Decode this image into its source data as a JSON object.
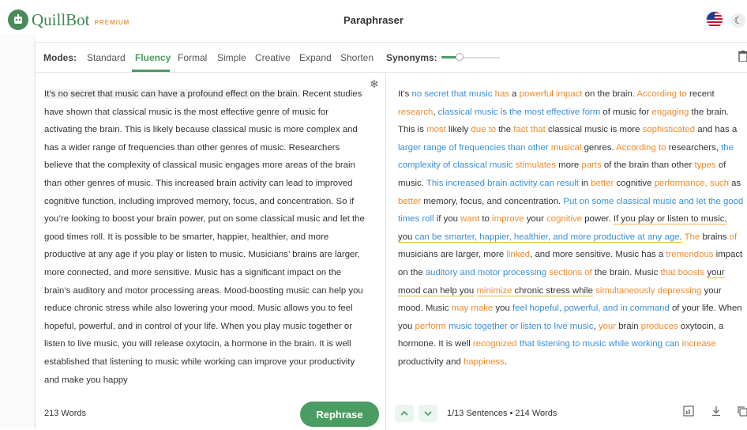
{
  "header": {
    "brand": "QuillBot",
    "brand_badge": "PREMIUM",
    "title": "Paraphraser",
    "flag_icon": "us-flag-icon",
    "theme_icon": "moon-icon"
  },
  "modes": {
    "label": "Modes:",
    "items": [
      "Standard",
      "Fluency",
      "Formal",
      "Simple",
      "Creative",
      "Expand",
      "Shorten"
    ],
    "active": "Fluency"
  },
  "synonyms": {
    "label": "Synonyms:",
    "level": 0.25
  },
  "input": {
    "first_sentence": "It’s no secret that music can have a profound effect on the brain.",
    "rest": " Recent studies have shown that classical music is the most effective genre of music for activating the brain. This is likely because classical music is more complex and has a wider range of frequencies than other genres of music. Researchers believe that the complexity of classical music engages more areas of the brain than other genres of music. This increased brain activity can lead to improved cognitive function, including improved memory, focus, and concentration. So if you’re looking to boost your brain power, put on some classical music and let the good times roll. It is possible to be smarter, happier, healthier, and more productive at any age if you play or listen to music. Musicians’ brains are larger, more connected, and more sensitive. Music has a significant impact on the brain’s auditory and motor processing areas. Mood-boosting music can help you reduce chronic stress while also lowering your mood. Music allows you to feel hopeful, powerful, and in control of your life. When you play music together or listen to live music, you will release oxytocin, a hormone in the brain. It is well established that listening to music while working can improve your productivity and make you happy",
    "word_count": "213 Words"
  },
  "output": {
    "segments": [
      {
        "t": "It’s ",
        "c": ""
      },
      {
        "t": "no secret that music",
        "c": "b"
      },
      {
        "t": " ",
        "c": ""
      },
      {
        "t": "has",
        "c": "o"
      },
      {
        "t": " a ",
        "c": ""
      },
      {
        "t": "powerful impact",
        "c": "o"
      },
      {
        "t": " on the brain. ",
        "c": ""
      },
      {
        "t": "According to",
        "c": "o"
      },
      {
        "t": " recent ",
        "c": ""
      },
      {
        "t": "research",
        "c": "o"
      },
      {
        "t": ", ",
        "c": ""
      },
      {
        "t": "classical music is the most effective",
        "c": "b"
      },
      {
        "t": " ",
        "c": ""
      },
      {
        "t": "form",
        "c": "b"
      },
      {
        "t": " of music for ",
        "c": ""
      },
      {
        "t": "engaging",
        "c": "o"
      },
      {
        "t": " the brain. This is ",
        "c": ""
      },
      {
        "t": "most",
        "c": "o"
      },
      {
        "t": " likely ",
        "c": ""
      },
      {
        "t": "due to",
        "c": "o"
      },
      {
        "t": " the ",
        "c": ""
      },
      {
        "t": "fact that",
        "c": "o"
      },
      {
        "t": " classical music is more ",
        "c": ""
      },
      {
        "t": "sophisticated",
        "c": "o"
      },
      {
        "t": " and has a ",
        "c": ""
      },
      {
        "t": "larger range of frequencies than other",
        "c": "b"
      },
      {
        "t": " ",
        "c": ""
      },
      {
        "t": "musical",
        "c": "o"
      },
      {
        "t": " genres. ",
        "c": ""
      },
      {
        "t": "According to",
        "c": "o"
      },
      {
        "t": " researchers, ",
        "c": ""
      },
      {
        "t": "the complexity of classical music",
        "c": "b"
      },
      {
        "t": " ",
        "c": ""
      },
      {
        "t": "stimulates",
        "c": "o"
      },
      {
        "t": " more ",
        "c": ""
      },
      {
        "t": "parts",
        "c": "o"
      },
      {
        "t": " of the brain than other ",
        "c": ""
      },
      {
        "t": "types",
        "c": "o"
      },
      {
        "t": " of music. ",
        "c": ""
      },
      {
        "t": "This increased brain activity can result",
        "c": "b"
      },
      {
        "t": " in ",
        "c": ""
      },
      {
        "t": "better",
        "c": "o"
      },
      {
        "t": " cognitive ",
        "c": ""
      },
      {
        "t": "performance, such",
        "c": "o"
      },
      {
        "t": " as ",
        "c": ""
      },
      {
        "t": "better",
        "c": "o"
      },
      {
        "t": " memory, focus, and concentration. ",
        "c": ""
      },
      {
        "t": "Put on some classical music and let the good times roll",
        "c": "b"
      },
      {
        "t": " if you ",
        "c": ""
      },
      {
        "t": "want",
        "c": "o"
      },
      {
        "t": " to ",
        "c": ""
      },
      {
        "t": "improve",
        "c": "o"
      },
      {
        "t": " your ",
        "c": ""
      },
      {
        "t": "cognitive",
        "c": "o"
      },
      {
        "t": " power. ",
        "c": ""
      },
      {
        "t": "If you play or listen to music, you ",
        "c": "u"
      },
      {
        "t": "can be smarter, happier, healthier, and more productive at any age",
        "c": "b u"
      },
      {
        "t": ".",
        "c": "u"
      },
      {
        "t": " ",
        "c": ""
      },
      {
        "t": "The",
        "c": "o"
      },
      {
        "t": " brains ",
        "c": ""
      },
      {
        "t": "of",
        "c": "o"
      },
      {
        "t": " musicians are larger, more ",
        "c": ""
      },
      {
        "t": "linked",
        "c": "o"
      },
      {
        "t": ", and more sensitive. Music has a ",
        "c": ""
      },
      {
        "t": "tremendous",
        "c": "o"
      },
      {
        "t": " impact on the ",
        "c": ""
      },
      {
        "t": "auditory and motor processing",
        "c": "b"
      },
      {
        "t": " ",
        "c": ""
      },
      {
        "t": "sections of",
        "c": "o"
      },
      {
        "t": " the brain. Music ",
        "c": ""
      },
      {
        "t": "that boosts",
        "c": "o"
      },
      {
        "t": " ",
        "c": ""
      },
      {
        "t": "your mood can help you",
        "c": "u"
      },
      {
        "t": " ",
        "c": ""
      },
      {
        "t": "minimize",
        "c": "o u"
      },
      {
        "t": " chronic stress while",
        "c": "u"
      },
      {
        "t": " ",
        "c": ""
      },
      {
        "t": "simultaneously depressing",
        "c": "o"
      },
      {
        "t": " your mood. Music ",
        "c": ""
      },
      {
        "t": "may make",
        "c": "o"
      },
      {
        "t": " you ",
        "c": ""
      },
      {
        "t": "feel hopeful, powerful, and in command",
        "c": "b"
      },
      {
        "t": " of your life. When you ",
        "c": ""
      },
      {
        "t": "perform",
        "c": "o"
      },
      {
        "t": " ",
        "c": ""
      },
      {
        "t": "music together or listen to live music",
        "c": "b"
      },
      {
        "t": ", ",
        "c": ""
      },
      {
        "t": "your",
        "c": "o"
      },
      {
        "t": " brain ",
        "c": ""
      },
      {
        "t": "produces",
        "c": "o"
      },
      {
        "t": " oxytocin, a hormone. It is well ",
        "c": ""
      },
      {
        "t": "recognized",
        "c": "o"
      },
      {
        "t": " ",
        "c": ""
      },
      {
        "t": "that listening to music while working can",
        "c": "b"
      },
      {
        "t": " ",
        "c": ""
      },
      {
        "t": "increase",
        "c": "o"
      },
      {
        "t": " productivity and ",
        "c": ""
      },
      {
        "t": "happiness",
        "c": "o"
      },
      {
        "t": ".",
        "c": ""
      }
    ],
    "sentence_info": "1/13 Sentences • 214 Words"
  },
  "actions": {
    "rephrase_label": "Rephrase"
  },
  "colors": {
    "accent": "#4a9c63",
    "changed_word": "#f08a2a",
    "structural_change": "#3a8fd8",
    "longest_unchanged": "#f2b43a"
  }
}
